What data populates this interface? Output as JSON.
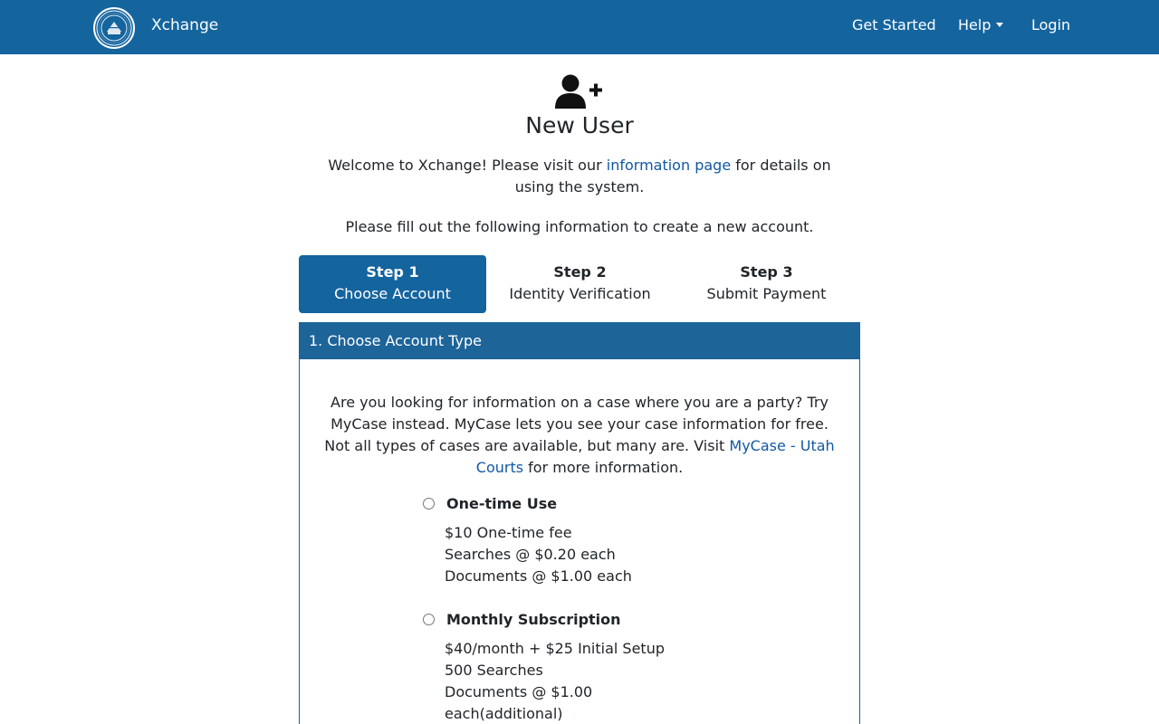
{
  "header": {
    "logo_icon": "seal-icon",
    "brand": "Xchange",
    "nav": {
      "get_started": "Get Started",
      "help": "Help",
      "login": "Login"
    }
  },
  "page": {
    "icon": "user-plus-icon",
    "title": "New User",
    "intro_before_link": "Welcome to Xchange! Please visit our ",
    "intro_link": "information page",
    "intro_after_link": " for details on using the system.",
    "intro_2": "Please fill out the following information to create a new account."
  },
  "steps": [
    {
      "title": "Step 1",
      "subtitle": "Choose Account",
      "active": true
    },
    {
      "title": "Step 2",
      "subtitle": "Identity Verification",
      "active": false
    },
    {
      "title": "Step 3",
      "subtitle": "Submit Payment",
      "active": false
    }
  ],
  "card": {
    "header": "1. Choose Account Type",
    "text_before_link": "Are you looking for information on a case where you are a party? Try MyCase instead. MyCase lets you see your case information for free. Not all types of cases are available, but many are. Visit ",
    "text_link": "MyCase - Utah Courts",
    "text_after_link": " for more information."
  },
  "options": [
    {
      "title": "One-time Use",
      "selected": false,
      "lines": [
        "$10 One-time fee",
        "Searches @ $0.20 each",
        "Documents @ $1.00 each"
      ]
    },
    {
      "title": "Monthly Subscription",
      "selected": false,
      "lines": [
        "$40/month + $25 Initial Setup",
        "500 Searches",
        "Documents @ $1.00",
        "each(additional)"
      ]
    }
  ],
  "colors": {
    "header_bg": "#14649e",
    "step_active_bg": "#14649e",
    "card_header_bg": "#1d6499",
    "link": "#1158a4"
  }
}
